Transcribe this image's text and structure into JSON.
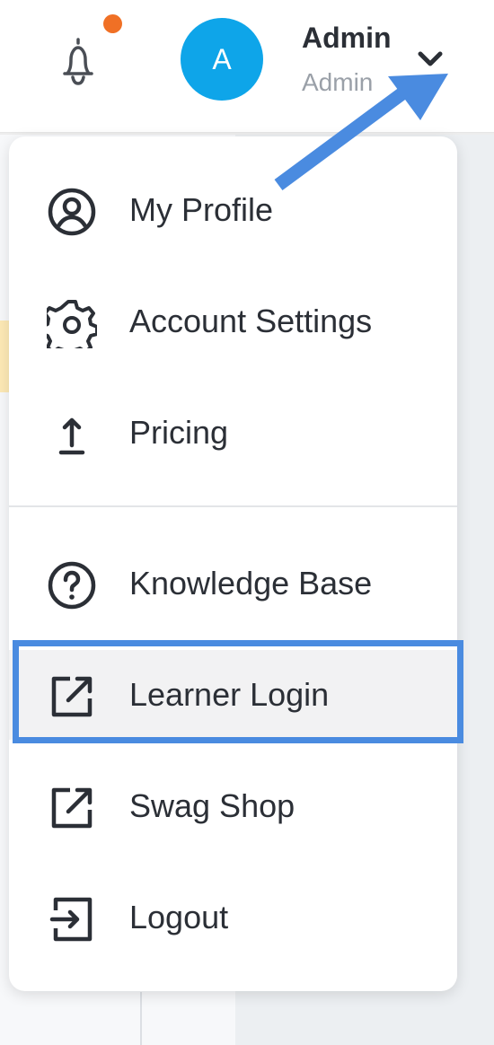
{
  "header": {
    "avatar_initial": "A",
    "user_name": "Admin",
    "user_role": "Admin",
    "notification_dot_color": "#f07025",
    "avatar_color": "#0ea5e9"
  },
  "menu": {
    "items": [
      {
        "label": "My Profile",
        "icon": "user-circle-icon"
      },
      {
        "label": "Account Settings",
        "icon": "gear-icon"
      },
      {
        "label": "Pricing",
        "icon": "upload-arrow-icon"
      },
      {
        "label": "Knowledge Base",
        "icon": "question-circle-icon"
      },
      {
        "label": "Learner Login",
        "icon": "external-link-icon"
      },
      {
        "label": "Swag Shop",
        "icon": "external-link-icon"
      },
      {
        "label": "Logout",
        "icon": "logout-icon"
      }
    ]
  },
  "annotation": {
    "highlight_color": "#4a8be0",
    "highlighted_item": "Learner Login"
  }
}
